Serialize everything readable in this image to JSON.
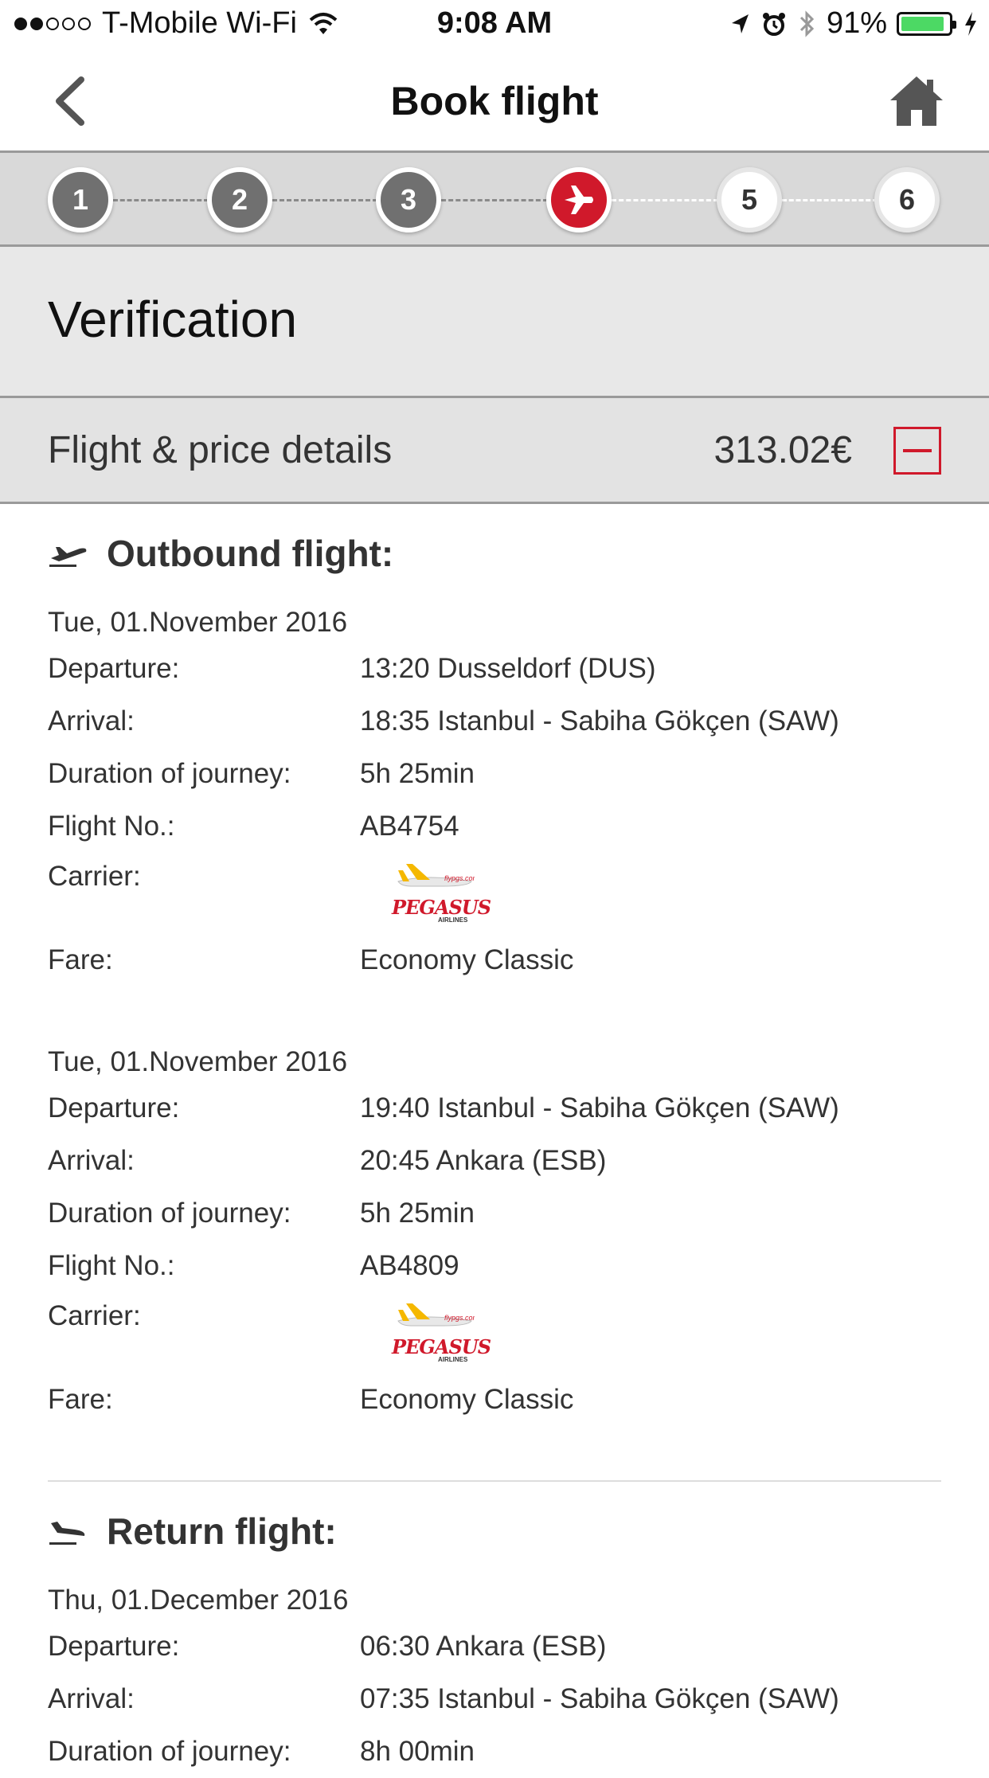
{
  "status_bar": {
    "carrier": "T-Mobile Wi-Fi",
    "time": "9:08 AM",
    "battery": "91%",
    "signal_bars_filled": 2,
    "signal_bars_total": 5,
    "battery_fraction": 0.91
  },
  "nav": {
    "title": "Book flight",
    "back_icon": "chevron-left-icon",
    "home_icon": "home-icon"
  },
  "stepper": {
    "steps": [
      {
        "label": "1",
        "state": "done"
      },
      {
        "label": "2",
        "state": "done"
      },
      {
        "label": "3",
        "state": "done"
      },
      {
        "label": "",
        "state": "active",
        "icon": "airplane-icon"
      },
      {
        "label": "5",
        "state": "todo"
      },
      {
        "label": "6",
        "state": "todo"
      }
    ],
    "active_color": "#d0192b"
  },
  "section": {
    "title": "Verification"
  },
  "price": {
    "label": "Flight & price details",
    "total": "313.02€",
    "toggle_icon": "collapse-minus-icon"
  },
  "labels": {
    "departure": "Departure:",
    "arrival": "Arrival:",
    "duration": "Duration of journey:",
    "flight_no": "Flight No.:",
    "carrier": "Carrier:",
    "fare": "Fare:"
  },
  "carrier_logo": {
    "name": "PEGASUS",
    "subtitle": "AIRLINES"
  },
  "outbound": {
    "heading": "Outbound flight:",
    "legs": [
      {
        "date": "Tue, 01.November 2016",
        "departure": "13:20 Dusseldorf (DUS)",
        "arrival": "18:35 Istanbul - Sabiha Gökçen (SAW)",
        "duration": "5h 25min",
        "flight_no": "AB4754",
        "fare": "Economy Classic"
      },
      {
        "date": "Tue, 01.November 2016",
        "departure": "19:40 Istanbul - Sabiha Gökçen (SAW)",
        "arrival": "20:45 Ankara (ESB)",
        "duration": "5h 25min",
        "flight_no": "AB4809",
        "fare": "Economy Classic"
      }
    ]
  },
  "return": {
    "heading": "Return flight:",
    "legs": [
      {
        "date": "Thu, 01.December 2016",
        "departure": "06:30 Ankara (ESB)",
        "arrival": "07:35 Istanbul - Sabiha Gökçen (SAW)",
        "duration": "8h 00min"
      }
    ]
  }
}
